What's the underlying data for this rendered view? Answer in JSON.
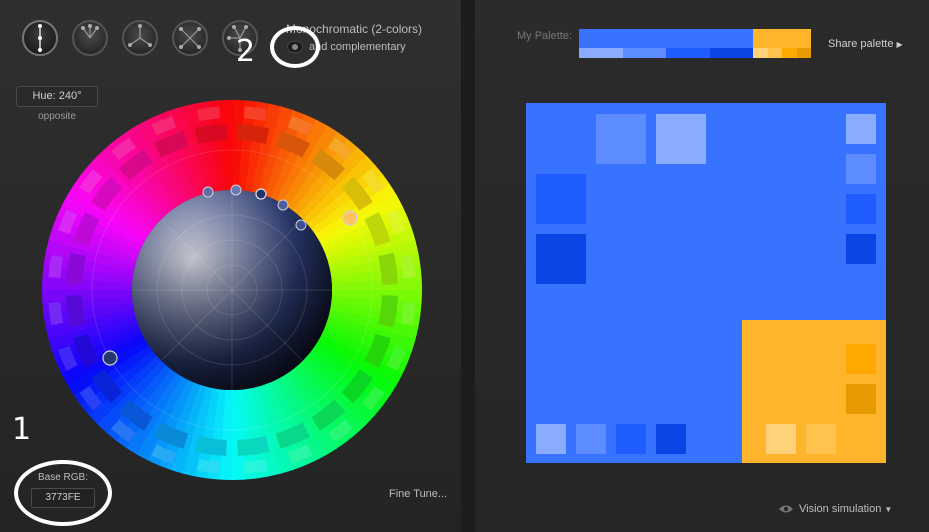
{
  "modes": [
    {
      "name": "monochromatic-mode-icon",
      "active": true
    },
    {
      "name": "adjacent-mode-icon",
      "active": false
    },
    {
      "name": "triad-mode-icon",
      "active": false
    },
    {
      "name": "tetrad-mode-icon",
      "active": false
    },
    {
      "name": "accented-analogic-mode-icon",
      "active": false
    }
  ],
  "scheme": {
    "title": "Monochromatic (2-colors)",
    "complementary_label": "and complementary"
  },
  "hue": {
    "label": "Hue: 240°",
    "opposite_label": "opposite"
  },
  "base": {
    "label": "Base RGB:",
    "value": "3773FE"
  },
  "fine_tune_label": "Fine Tune...",
  "palette": {
    "label": "My Palette:",
    "share_label": "Share palette",
    "primary": "#3773FE",
    "primary_variants": [
      "#8aacff",
      "#5c8cff",
      "#1e5cff",
      "#0a45e6"
    ],
    "complement": "#FFB52B",
    "complement_variants": [
      "#ffd27a",
      "#ffc34e",
      "#ffa800",
      "#e69a00"
    ]
  },
  "vision_label": "Vision simulation",
  "annotations": [
    "1",
    "2"
  ]
}
